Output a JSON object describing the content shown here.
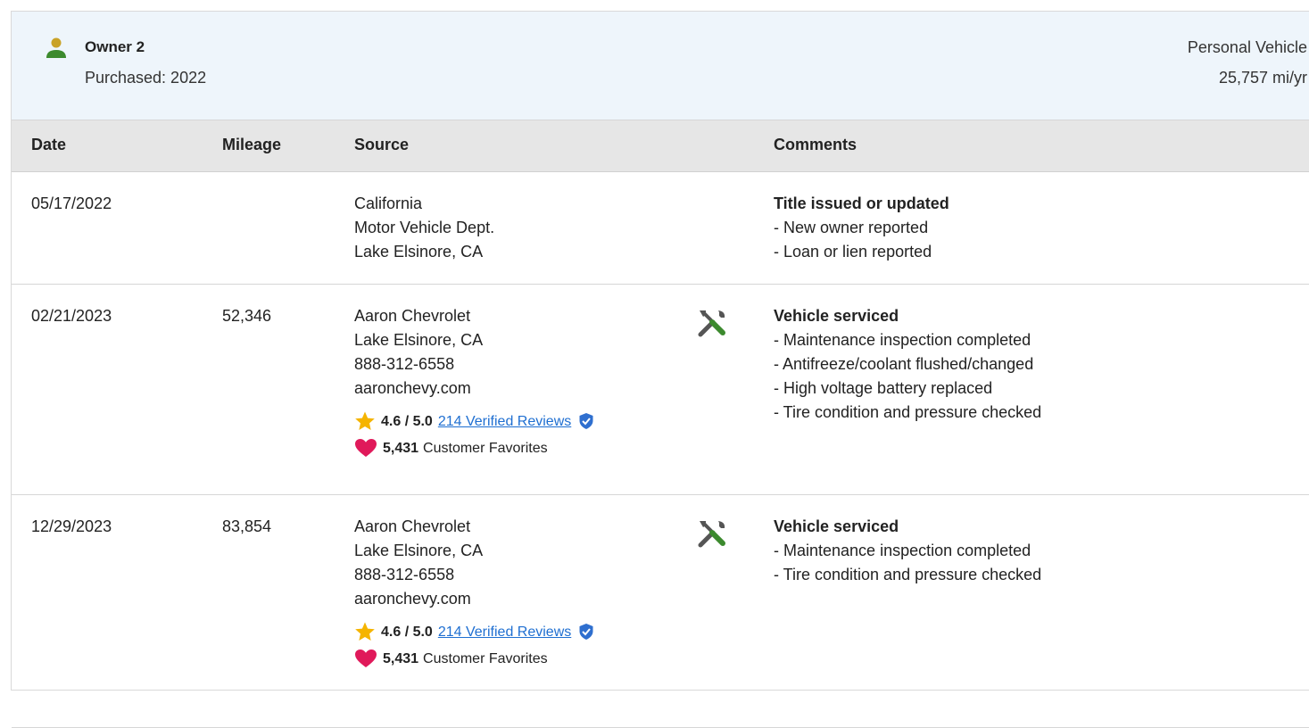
{
  "owner": {
    "name": "Owner 2",
    "purchased": "Purchased: 2022",
    "vehicle_type": "Personal Vehicle",
    "mileage_rate": "25,757 mi/yr"
  },
  "columns": {
    "date": "Date",
    "mileage": "Mileage",
    "source": "Source",
    "comments": "Comments"
  },
  "records": [
    {
      "date": "05/17/2022",
      "mileage": "",
      "source": [
        "California",
        "Motor Vehicle Dept.",
        "Lake Elsinore, CA"
      ],
      "comment_title": "Title issued or updated",
      "comments": [
        "- New owner reported",
        "- Loan or lien reported"
      ]
    },
    {
      "date": "02/21/2023",
      "mileage": "52,346",
      "source": [
        "Aaron Chevrolet",
        "Lake Elsinore, CA",
        "888-312-6558",
        "aaronchevy.com"
      ],
      "rating": "4.6 / 5.0",
      "reviews": "214 Verified Reviews",
      "favorites_count": "5,431",
      "favorites_label": "Customer Favorites",
      "comment_title": "Vehicle serviced",
      "comments": [
        "- Maintenance inspection completed",
        "- Antifreeze/coolant flushed/changed",
        "- High voltage battery replaced",
        "- Tire condition and pressure checked"
      ]
    },
    {
      "date": "12/29/2023",
      "mileage": "83,854",
      "source": [
        "Aaron Chevrolet",
        "Lake Elsinore, CA",
        "888-312-6558",
        "aaronchevy.com"
      ],
      "rating": "4.6 / 5.0",
      "reviews": "214 Verified Reviews",
      "favorites_count": "5,431",
      "favorites_label": "Customer Favorites",
      "comment_title": "Vehicle serviced",
      "comments": [
        "- Maintenance inspection completed",
        "- Tire condition and pressure checked"
      ]
    }
  ],
  "icons": {
    "owner": "person-icon",
    "service": "tools-icon",
    "rating": "star-icon",
    "verified": "shield-check-icon",
    "favorites": "heart-icon"
  },
  "colors": {
    "owner_icon_head": "#c9a227",
    "owner_icon_body": "#3c8a2e",
    "link": "#1f6fd1",
    "star": "#f5b400",
    "heart": "#e0195a",
    "header_bg": "#eef5fb"
  }
}
